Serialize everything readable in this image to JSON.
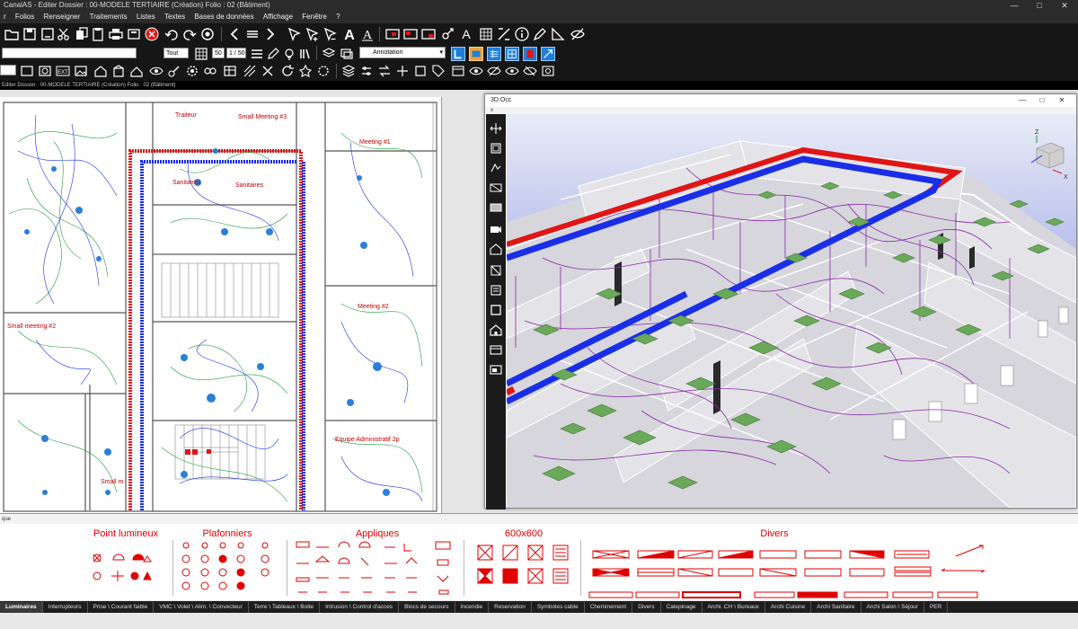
{
  "window": {
    "title": "CanalAS - Editer Dossier : 00-MODELE TERTIAIRE (Création) Folio : 02 (Bâtiment)",
    "min": "—",
    "max": "□",
    "close": "✕"
  },
  "menu": [
    "r",
    "Folios",
    "Renseigner",
    "Traitements",
    "Listes",
    "Textes",
    "Bases de données",
    "Affichage",
    "Fenêtre",
    "?"
  ],
  "toolbar": {
    "scale_value": "Tout",
    "zoom_value": "50",
    "ratio_value": "1 / 50",
    "layer_select": "Annotation"
  },
  "document_bar": "Editer Dossier : 00-MODELE TERTIAIRE (Création) Folio : 02 (Bâtiment)",
  "plan": {
    "rooms": [
      "Traiteur",
      "Small Meeting #3",
      "Meeting #1",
      "Sanitaires",
      "Sanitaires",
      "Meeting #2",
      "Small meeting #2",
      "Equipe Administratif 2p",
      "Small m"
    ]
  },
  "viewer": {
    "title": "3D Occ",
    "subbar": "x",
    "axis_x": "X",
    "axis_z": "Z"
  },
  "status_text": "que",
  "palette": {
    "groups": [
      {
        "title": "Point lumineux"
      },
      {
        "title": "Plafonniers"
      },
      {
        "title": "Appliques"
      },
      {
        "title": "600x600"
      },
      {
        "title": "Divers"
      }
    ]
  },
  "tabs": [
    {
      "label": "Luminaires",
      "active": true
    },
    {
      "label": "Interrupteurs",
      "active": false
    },
    {
      "label": "Prise \\ Courant faible",
      "active": false
    },
    {
      "label": "VMC \\ Volet \\ Alim. \\ Convecteur",
      "active": false
    },
    {
      "label": "Terre \\ Tableaux \\ Boite",
      "active": false
    },
    {
      "label": "Intrusion \\ Control d'acces",
      "active": false
    },
    {
      "label": "Blocs de secours",
      "active": false
    },
    {
      "label": "Incendie",
      "active": false
    },
    {
      "label": "Reservation",
      "active": false
    },
    {
      "label": "Symboles cable",
      "active": false
    },
    {
      "label": "Cheminement",
      "active": false
    },
    {
      "label": "Divers",
      "active": false
    },
    {
      "label": "Calepinage",
      "active": false
    },
    {
      "label": "Archi. CH \\ Bureaux",
      "active": false
    },
    {
      "label": "Archi Cuisine",
      "active": false
    },
    {
      "label": "Archi Sanitaire",
      "active": false
    },
    {
      "label": "Archi Salon \\ Séjour",
      "active": false
    },
    {
      "label": "PER",
      "active": false
    }
  ],
  "colors": {
    "accent_red": "#e00000",
    "duct_blue": "#1a2ee8",
    "duct_red": "#e01515",
    "wire_purple": "#8a2aa8",
    "fixture_green": "#6aa85a",
    "viewport_top": "#e9ecf6",
    "viewport_bottom": "#5c6ad8"
  },
  "icons": {
    "toolbar_row1": [
      "new-folder-icon",
      "save-icon",
      "save-as-icon",
      "cut-icon",
      "copy-icon",
      "paste-icon",
      "print-icon",
      "print-preview-icon",
      "cancel-icon",
      "undo-icon",
      "redo-icon",
      "refresh-icon",
      "chevron-left-icon",
      "equals-icon",
      "chevron-right-icon",
      "pointer-icon",
      "pointer-add-icon",
      "pointer-minus-icon",
      "text-icon",
      "text-style-icon",
      "image-icon",
      "image-frame-icon",
      "grid-icon",
      "info-icon",
      "pen-icon",
      "measure-icon",
      "eye-off-icon"
    ],
    "toolbar_row2": [
      "menu-icon",
      "grid-icon",
      "list-icon",
      "pencil-icon",
      "bulb-icon",
      "stack-icon",
      "layers-icon",
      "settings-icon"
    ],
    "toolbar_row3": [
      "rectangle-icon",
      "circle-rect-icon",
      "ext-icon",
      "image-icon",
      "home-icon",
      "building-icon",
      "roof-icon",
      "eye-icon",
      "tools-icon"
    ]
  }
}
